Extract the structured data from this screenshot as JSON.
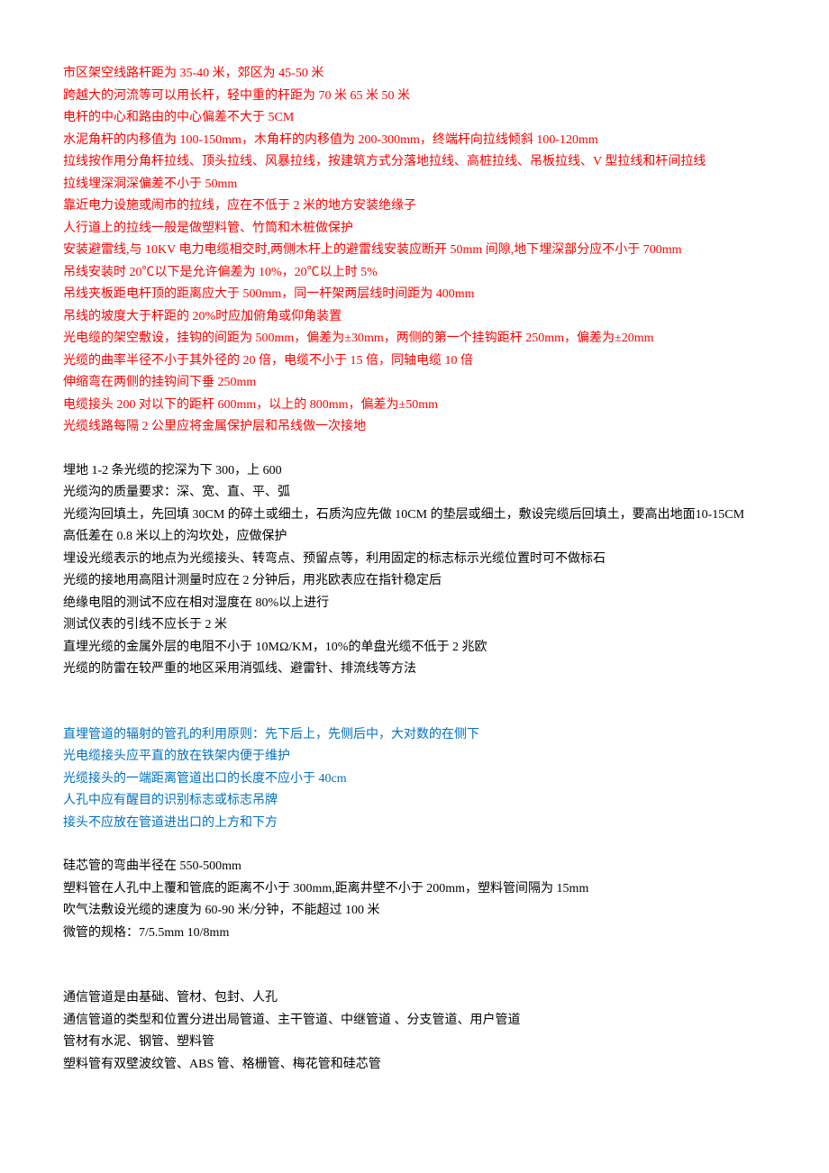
{
  "section_red": [
    "市区架空线路杆距为 35-40 米，郊区为 45-50 米",
    "跨越大的河流等可以用长杆，轻中重的杆距为 70 米 65 米 50 米",
    "电杆的中心和路由的中心偏差不大于 5CM",
    "水泥角杆的内移值为 100-150mm，木角杆的内移值为 200-300mm，终端杆向拉线倾斜 100-120mm",
    "拉线按作用分角杆拉线、顶头拉线、风暴拉线，按建筑方式分落地拉线、高桩拉线、吊板拉线、V 型拉线和杆间拉线",
    "拉线埋深洞深偏差不小于 50mm",
    "靠近电力设施或闹市的拉线，应在不低于 2 米的地方安装绝缘子",
    "人行道上的拉线一般是做塑料管、竹筒和木桩做保护",
    "安装避雷线,与 10KV 电力电缆相交时,两侧木杆上的避雷线安装应断开 50mm 间隙,地下埋深部分应不小于 700mm",
    "吊线安装时 20℃以下是允许偏差为 10%，20℃以上时 5%",
    "吊线夹板距电杆顶的距离应大于 500mm，同一杆架两层线时间距为 400mm",
    "吊线的坡度大于杆距的 20%时应加俯角或仰角装置",
    "光电缆的架空敷设，挂钩的间距为 500mm，偏差为±30mm，两侧的第一个挂钩距杆 250mm，偏差为±20mm",
    "光缆的曲率半径不小于其外径的 20 倍，电缆不小于 15 倍，同轴电缆 10 倍",
    "伸缩弯在两侧的挂钩间下垂 250mm",
    "电缆接头 200 对以下的距杆 600mm，以上的 800mm，偏差为±50mm",
    "光缆线路每隔 2 公里应将金属保护层和吊线做一次接地"
  ],
  "section_black1": [
    "埋地 1-2 条光缆的挖深为下 300，上 600",
    "光缆沟的质量要求：深、宽、直、平、弧",
    "光缆沟回填土，先回填 30CM 的碎土或细土，石质沟应先做 10CM 的垫层或细土，敷设完缆后回填土，要高出地面10-15CM",
    "高低差在 0.8 米以上的沟坎处，应做保护",
    "埋设光缆表示的地点为光缆接头、转弯点、预留点等，利用固定的标志标示光缆位置时可不做标石",
    "光缆的接地用高阻计测量时应在 2 分钟后，用兆欧表应在指针稳定后",
    "绝缘电阻的测试不应在相对湿度在 80%以上进行",
    "测试仪表的引线不应长于 2 米",
    "直埋光缆的金属外层的电阻不小于 10MΩ/KM，10%的单盘光缆不低于 2 兆欧",
    "光缆的防雷在较严重的地区采用消弧线、避雷针、排流线等方法"
  ],
  "section_blue": [
    "直埋管道的辐射的管孔的利用原则：先下后上，先侧后中，大对数的在侧下",
    "光电缆接头应平直的放在铁架内便于维护",
    "光缆接头的一端距离管道出口的长度不应小于 40cm",
    "人孔中应有醒目的识别标志或标志吊牌",
    "接头不应放在管道进出口的上方和下方"
  ],
  "section_black2": [
    "硅芯管的弯曲半径在 550-500mm",
    "塑料管在人孔中上覆和管底的距离不小于 300mm,距离井壁不小于 200mm，塑料管间隔为 15mm",
    "吹气法敷设光缆的速度为 60-90 米/分钟，不能超过 100 米",
    "微管的规格：7/5.5mm    10/8mm"
  ],
  "section_black3": [
    "通信管道是由基础、管材、包封、人孔",
    "通信管道的类型和位置分进出局管道、主干管道、中继管道 、分支管道、用户管道",
    "管材有水泥、钢管、塑料管",
    "塑料管有双壁波纹管、ABS 管、格栅管、梅花管和硅芯管"
  ]
}
